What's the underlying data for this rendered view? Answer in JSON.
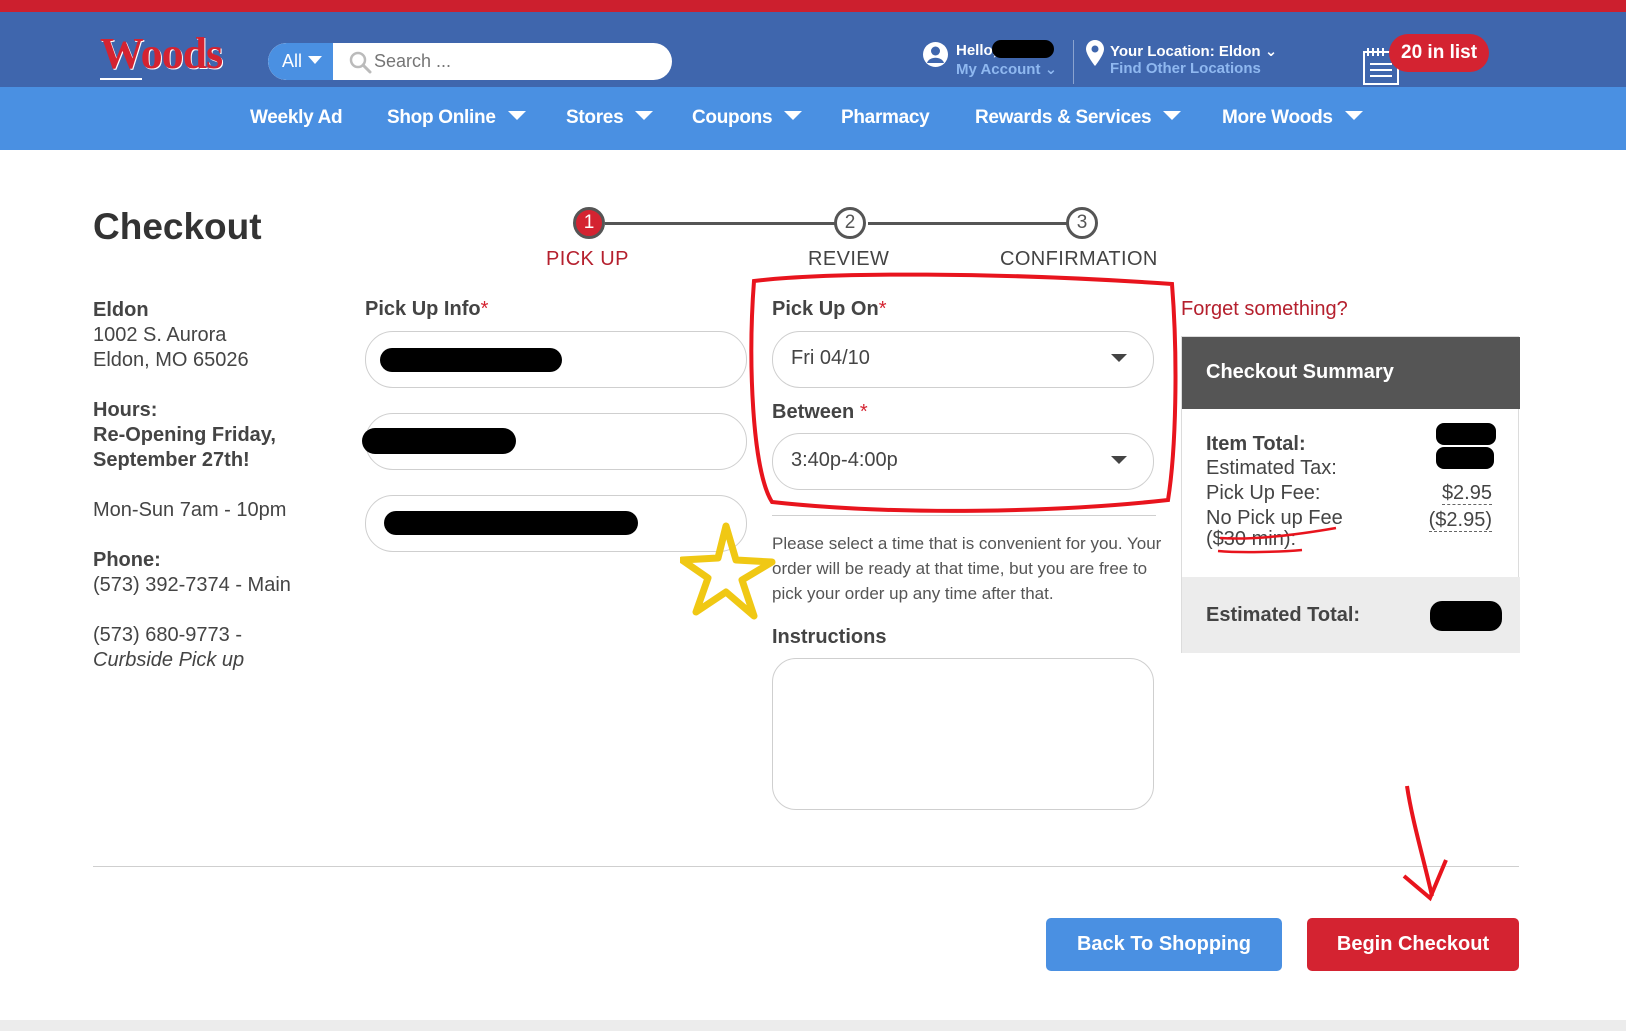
{
  "header": {
    "brand": "Woods",
    "search": {
      "scope": "All",
      "placeholder": "Search ..."
    },
    "account": {
      "greeting": "Hello,",
      "link": "My Account"
    },
    "location": {
      "label": "Your Location: Eldon",
      "link": "Find Other Locations"
    },
    "list_badge": "20 in list"
  },
  "nav": {
    "items": [
      {
        "label": "Weekly Ad"
      },
      {
        "label": "Shop Online"
      },
      {
        "label": "Stores"
      },
      {
        "label": "Coupons"
      },
      {
        "label": "Pharmacy"
      },
      {
        "label": "Rewards & Services"
      },
      {
        "label": "More Woods"
      }
    ]
  },
  "page": {
    "title": "Checkout"
  },
  "steps": [
    {
      "number": "1",
      "label": "PICK UP",
      "active": true
    },
    {
      "number": "2",
      "label": "REVIEW",
      "active": false
    },
    {
      "number": "3",
      "label": "CONFIRMATION",
      "active": false
    }
  ],
  "store": {
    "name": "Eldon",
    "address1": "1002 S. Aurora",
    "address2": "Eldon, MO 65026",
    "hours_label": "Hours:",
    "notice1": "Re-Opening Friday,",
    "notice2": "September 27th!",
    "hours": "Mon-Sun 7am - 10pm",
    "phone_label": "Phone:",
    "phone_main": "(573) 392-7374 - Main",
    "phone_curbside": "(573) 680-9773 -",
    "curbside_label": "Curbside Pick up"
  },
  "pickup_info": {
    "label": "Pick Up Info",
    "required_mark": "*"
  },
  "pickup_on": {
    "label": "Pick Up On",
    "required_mark": "*",
    "value": "Fri 04/10"
  },
  "between": {
    "label": "Between",
    "required_mark": "*",
    "value": "3:40p-4:00p"
  },
  "hint": "Please select a time that is convenient for you. Your order will be ready at that time, but you are free to pick your order up any time after that.",
  "instructions": {
    "label": "Instructions",
    "value": ""
  },
  "summary": {
    "forget_link": "Forget something?",
    "title": "Checkout Summary",
    "item_total_label": "Item Total:",
    "tax_label": "Estimated Tax:",
    "pickup_fee_label": "Pick Up Fee:",
    "pickup_fee_value": "$2.95",
    "no_fee_label_1": "No Pick up Fee",
    "no_fee_label_2": "($30 min):",
    "no_fee_value": "($2.95)",
    "estimated_total_label": "Estimated Total:"
  },
  "buttons": {
    "back": "Back To Shopping",
    "begin": "Begin Checkout"
  },
  "colors": {
    "brand_red": "#d42331",
    "header_blue": "#3f66ad",
    "nav_blue": "#4a90e2"
  }
}
